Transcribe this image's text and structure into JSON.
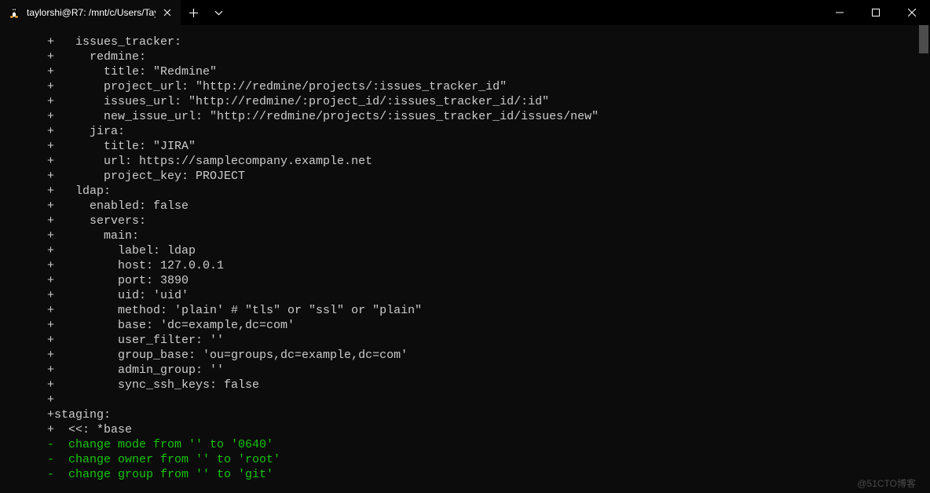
{
  "titlebar": {
    "tab": {
      "title": "taylorshi@R7: /mnt/c/Users/Tay"
    }
  },
  "terminal": {
    "lines": [
      {
        "cls": "",
        "text": "+   issues_tracker:"
      },
      {
        "cls": "",
        "text": "+     redmine:"
      },
      {
        "cls": "",
        "text": "+       title: \"Redmine\""
      },
      {
        "cls": "",
        "text": "+       project_url: \"http://redmine/projects/:issues_tracker_id\""
      },
      {
        "cls": "",
        "text": "+       issues_url: \"http://redmine/:project_id/:issues_tracker_id/:id\""
      },
      {
        "cls": "",
        "text": "+       new_issue_url: \"http://redmine/projects/:issues_tracker_id/issues/new\""
      },
      {
        "cls": "",
        "text": "+     jira:"
      },
      {
        "cls": "",
        "text": "+       title: \"JIRA\""
      },
      {
        "cls": "",
        "text": "+       url: https://samplecompany.example.net"
      },
      {
        "cls": "",
        "text": "+       project_key: PROJECT"
      },
      {
        "cls": "",
        "text": "+   ldap:"
      },
      {
        "cls": "",
        "text": "+     enabled: false"
      },
      {
        "cls": "",
        "text": "+     servers:"
      },
      {
        "cls": "",
        "text": "+       main:"
      },
      {
        "cls": "",
        "text": "+         label: ldap"
      },
      {
        "cls": "",
        "text": "+         host: 127.0.0.1"
      },
      {
        "cls": "",
        "text": "+         port: 3890"
      },
      {
        "cls": "",
        "text": "+         uid: 'uid'"
      },
      {
        "cls": "",
        "text": "+         method: 'plain' # \"tls\" or \"ssl\" or \"plain\""
      },
      {
        "cls": "",
        "text": "+         base: 'dc=example,dc=com'"
      },
      {
        "cls": "",
        "text": "+         user_filter: ''"
      },
      {
        "cls": "",
        "text": "+         group_base: 'ou=groups,dc=example,dc=com'"
      },
      {
        "cls": "",
        "text": "+         admin_group: ''"
      },
      {
        "cls": "",
        "text": "+         sync_ssh_keys: false"
      },
      {
        "cls": "",
        "text": "+"
      },
      {
        "cls": "",
        "text": "+staging:"
      },
      {
        "cls": "",
        "text": "+  <<: *base"
      },
      {
        "cls": "green",
        "text": "-  change mode from '' to '0640'"
      },
      {
        "cls": "green",
        "text": "-  change owner from '' to 'root'"
      },
      {
        "cls": "green",
        "text": "-  change group from '' to 'git'"
      }
    ]
  },
  "watermark": "@51CTO博客"
}
